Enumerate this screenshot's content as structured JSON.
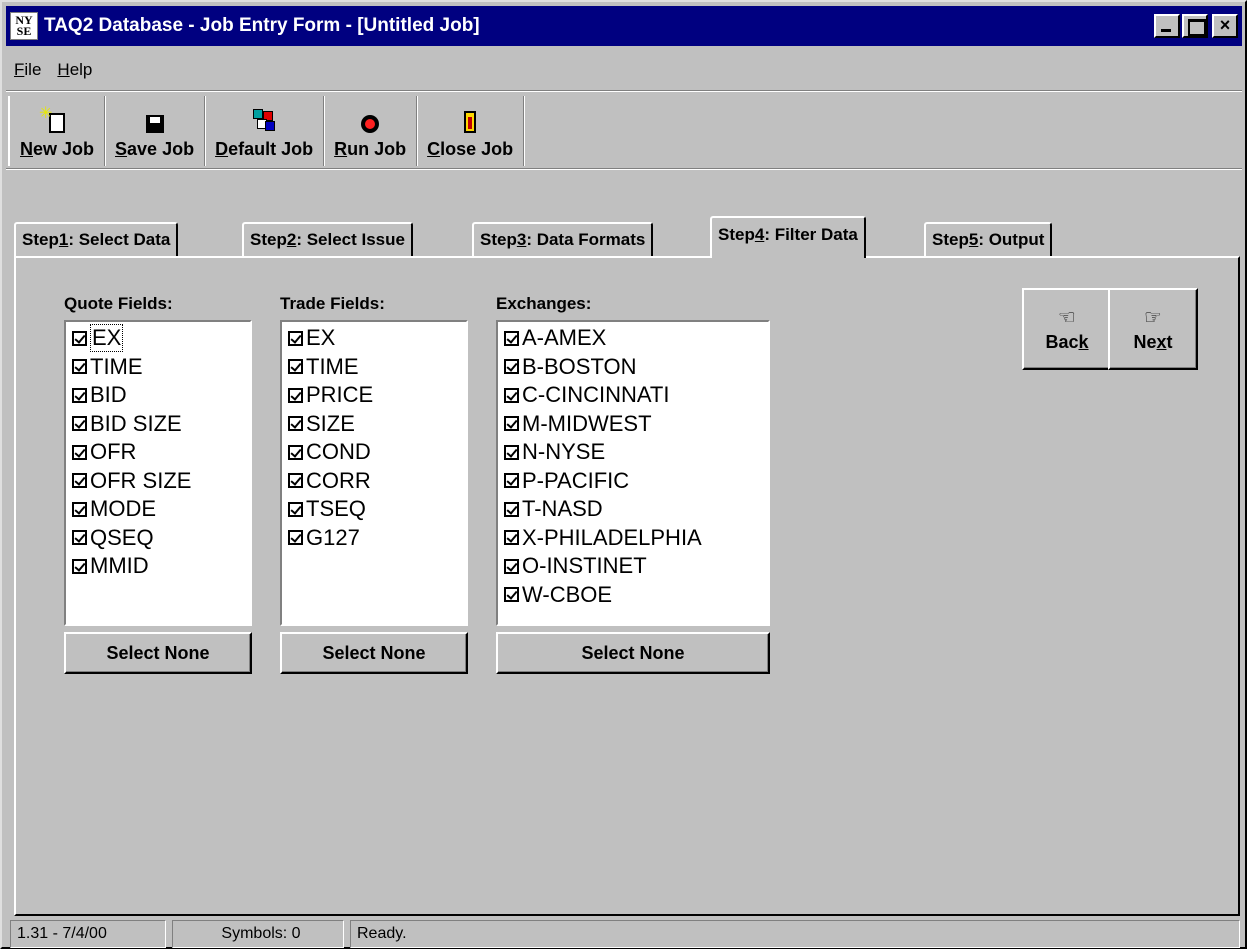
{
  "window": {
    "app_icon_text": [
      "NY",
      "SE"
    ],
    "title": "TAQ2 Database - Job Entry Form - [Untitled Job]",
    "controls": {
      "minimize": "_",
      "maximize": "□",
      "close": "×"
    }
  },
  "menu": {
    "items": [
      {
        "label_ul": "F",
        "label_rest": "ile"
      },
      {
        "label_ul": "H",
        "label_rest": "elp"
      }
    ]
  },
  "toolbar": {
    "buttons": [
      {
        "icon": "new-job-icon",
        "ul": "N",
        "rest": "ew Job"
      },
      {
        "icon": "save-job-icon",
        "ul": "S",
        "rest": "ave Job"
      },
      {
        "icon": "default-job-icon",
        "ul": "D",
        "rest": "efault Job"
      },
      {
        "icon": "run-job-icon",
        "ul": "R",
        "rest": "un Job"
      },
      {
        "icon": "close-job-icon",
        "ul": "C",
        "rest": "lose Job"
      }
    ]
  },
  "tabs": [
    {
      "pre": "Step ",
      "ul": "1",
      "post": ": Select Data",
      "active": false
    },
    {
      "pre": "Step ",
      "ul": "2",
      "post": ": Select Issue",
      "active": false
    },
    {
      "pre": "Step ",
      "ul": "3",
      "post": ": Data Formats",
      "active": false
    },
    {
      "pre": "Step ",
      "ul": "4",
      "post": ": Filter Data",
      "active": true
    },
    {
      "pre": "Step ",
      "ul": "5",
      "post": ": Output",
      "active": false
    }
  ],
  "quote_fields": {
    "label": "Quote Fields:",
    "items": [
      "EX",
      "TIME",
      "BID",
      "BID SIZE",
      "OFR",
      "OFR SIZE",
      "MODE",
      "QSEQ",
      "MMID"
    ],
    "checked": [
      true,
      true,
      true,
      true,
      true,
      true,
      true,
      true,
      true
    ],
    "select_none": "Select None"
  },
  "trade_fields": {
    "label": "Trade Fields:",
    "items": [
      "EX",
      "TIME",
      "PRICE",
      "SIZE",
      "COND",
      "CORR",
      "TSEQ",
      "G127"
    ],
    "checked": [
      true,
      true,
      true,
      true,
      true,
      true,
      true,
      true
    ],
    "select_none": "Select None"
  },
  "exchanges": {
    "label": "Exchanges:",
    "items": [
      "A-AMEX",
      "B-BOSTON",
      "C-CINCINNATI",
      "M-MIDWEST",
      "N-NYSE",
      "P-PACIFIC",
      "T-NASD",
      "X-PHILADELPHIA",
      "O-INSTINET",
      "W-CBOE"
    ],
    "checked": [
      true,
      true,
      true,
      true,
      true,
      true,
      true,
      true,
      true,
      true
    ],
    "select_none": "Select None"
  },
  "nav": {
    "back_pre": "Bac",
    "back_ul": "k",
    "next_pre": "Ne",
    "next_ul": "x",
    "next_post": "t"
  },
  "status": {
    "version": "1.31 - 7/4/00",
    "symbols": "Symbols: 0",
    "message": "Ready."
  },
  "colors": {
    "title_bar": "#000080",
    "face": "#c0c0c0"
  }
}
